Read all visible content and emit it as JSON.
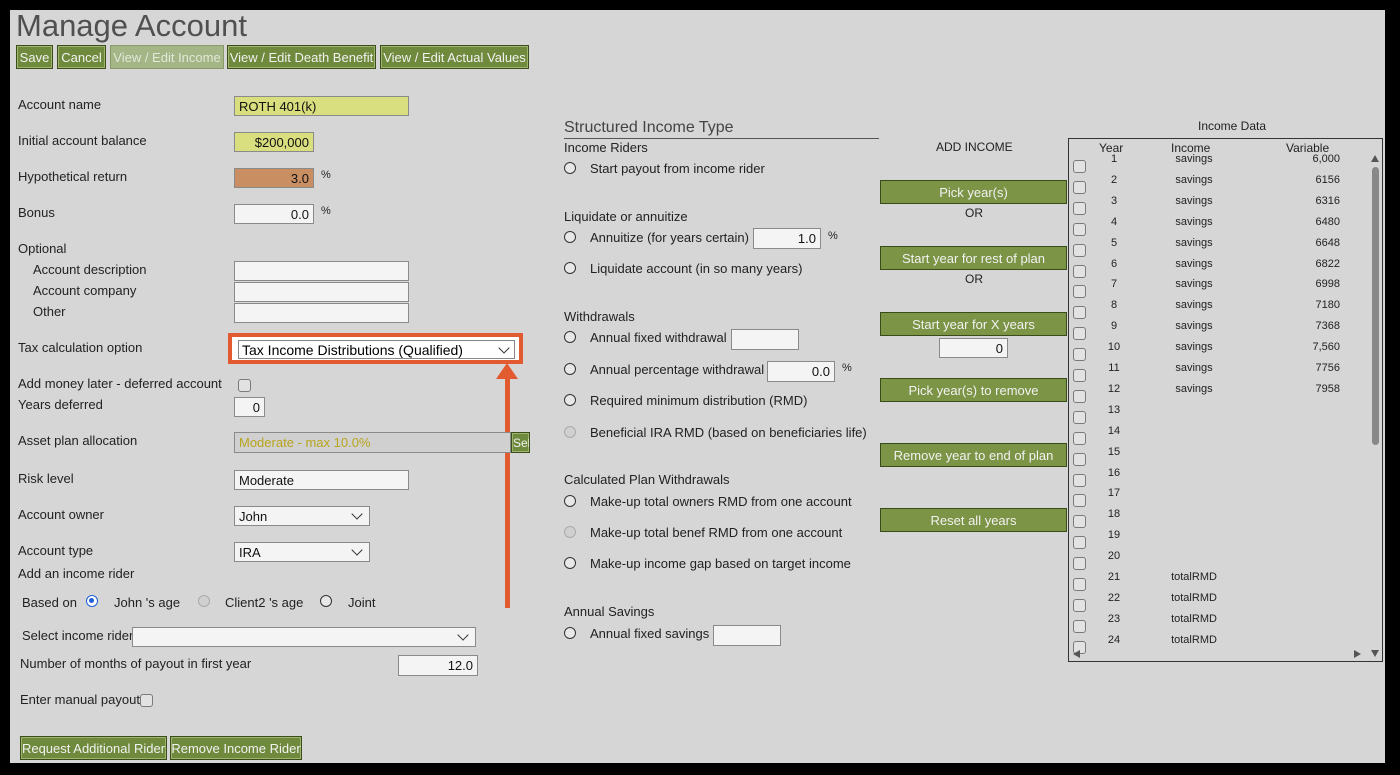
{
  "header": {
    "title": "Manage Account",
    "buttons": {
      "save": "Save",
      "cancel": "Cancel",
      "view_income": "View / Edit Income",
      "view_death": "View / Edit Death Benefit",
      "view_actual": "View / Edit Actual Values"
    }
  },
  "form": {
    "account_name": {
      "label": "Account name",
      "value": "ROTH 401(k)"
    },
    "initial_balance": {
      "label": "Initial account balance",
      "value": "$200,000"
    },
    "hypothetical_return": {
      "label": "Hypothetical return",
      "value": "3.0",
      "unit": "%"
    },
    "bonus": {
      "label": "Bonus",
      "value": "0.0",
      "unit": "%"
    },
    "optional": {
      "label": "Optional"
    },
    "account_description": {
      "label": "Account description",
      "value": ""
    },
    "account_company": {
      "label": "Account company",
      "value": ""
    },
    "other": {
      "label": "Other",
      "value": ""
    },
    "tax_option": {
      "label": "Tax calculation option",
      "value": "Tax Income Distributions (Qualified)"
    },
    "add_money_later": {
      "label": "Add money later - deferred account"
    },
    "years_deferred": {
      "label": "Years deferred",
      "value": "0"
    },
    "asset_plan": {
      "label": "Asset plan allocation",
      "value": "Moderate - max 10.0%",
      "button": "Sel"
    },
    "risk_level": {
      "label": "Risk level",
      "value": "Moderate"
    },
    "account_owner": {
      "label": "Account owner",
      "value": "John"
    },
    "account_type": {
      "label": "Account type",
      "value": "IRA"
    },
    "add_rider": {
      "label": "Add an income rider"
    },
    "based_on": {
      "label": "Based on",
      "options": [
        "John 's age",
        "Client2 's age",
        "Joint"
      ]
    },
    "select_rider": {
      "label": "Select income rider",
      "value": ""
    },
    "months_payout": {
      "label": "Number of months of payout in first year",
      "value": "12.0"
    },
    "manual_payout": {
      "label": "Enter manual payout"
    },
    "request_rider_button": "Request Additional Rider",
    "remove_rider_button": "Remove Income Rider"
  },
  "structured": {
    "title": "Structured Income Type",
    "income_riders": {
      "heading": "Income Riders",
      "start_payout": "Start payout from income rider"
    },
    "liquidate": {
      "heading": "Liquidate or annuitize",
      "annuitize": "Annuitize (for years certain)",
      "annuitize_value": "1.0",
      "unit": "%",
      "liquidate": "Liquidate account (in so many years)"
    },
    "withdrawals": {
      "heading": "Withdrawals",
      "fixed": "Annual fixed withdrawal",
      "fixed_value": "",
      "percentage": "Annual percentage withdrawal",
      "percentage_value": "0.0",
      "unit": "%",
      "rmd": "Required minimum distribution (RMD)",
      "beneficial": "Beneficial IRA RMD (based on beneficiaries life)"
    },
    "calculated": {
      "heading": "Calculated Plan Withdrawals",
      "owners": "Make-up total owners RMD from one account",
      "benef": "Make-up total benef RMD from one account",
      "gap": "Make-up income gap based on target income"
    },
    "savings": {
      "heading": "Annual Savings",
      "fixed": "Annual fixed savings",
      "fixed_value": ""
    }
  },
  "add_income": {
    "title": "ADD INCOME",
    "pick_years": "Pick year(s)",
    "or": "OR",
    "start_rest": "Start year for rest of plan",
    "start_x": "Start year for X years",
    "x_value": "0",
    "pick_remove": "Pick year(s) to remove",
    "remove_end": "Remove year to end of plan",
    "reset": "Reset all years"
  },
  "income_data": {
    "title": "Income Data",
    "columns": [
      "Year",
      "Income",
      "Variable"
    ],
    "rows": [
      {
        "year": "1",
        "income": "savings",
        "variable": "6,000"
      },
      {
        "year": "2",
        "income": "savings",
        "variable": "6156"
      },
      {
        "year": "3",
        "income": "savings",
        "variable": "6316"
      },
      {
        "year": "4",
        "income": "savings",
        "variable": "6480"
      },
      {
        "year": "5",
        "income": "savings",
        "variable": "6648"
      },
      {
        "year": "6",
        "income": "savings",
        "variable": "6822"
      },
      {
        "year": "7",
        "income": "savings",
        "variable": "6998"
      },
      {
        "year": "8",
        "income": "savings",
        "variable": "7180"
      },
      {
        "year": "9",
        "income": "savings",
        "variable": "7368"
      },
      {
        "year": "10",
        "income": "savings",
        "variable": "7,560"
      },
      {
        "year": "11",
        "income": "savings",
        "variable": "7756"
      },
      {
        "year": "12",
        "income": "savings",
        "variable": "7958"
      },
      {
        "year": "13",
        "income": "",
        "variable": ""
      },
      {
        "year": "14",
        "income": "",
        "variable": ""
      },
      {
        "year": "15",
        "income": "",
        "variable": ""
      },
      {
        "year": "16",
        "income": "",
        "variable": ""
      },
      {
        "year": "17",
        "income": "",
        "variable": ""
      },
      {
        "year": "18",
        "income": "",
        "variable": ""
      },
      {
        "year": "19",
        "income": "",
        "variable": ""
      },
      {
        "year": "20",
        "income": "",
        "variable": ""
      },
      {
        "year": "21",
        "income": "totalRMD",
        "variable": ""
      },
      {
        "year": "22",
        "income": "totalRMD",
        "variable": ""
      },
      {
        "year": "23",
        "income": "totalRMD",
        "variable": ""
      },
      {
        "year": "24",
        "income": "totalRMD",
        "variable": ""
      }
    ]
  },
  "colors": {
    "button_green": "#6f8a3c",
    "highlight": "#e25a30",
    "field_yellow": "#d9de7e",
    "field_orange": "#c98f63"
  }
}
